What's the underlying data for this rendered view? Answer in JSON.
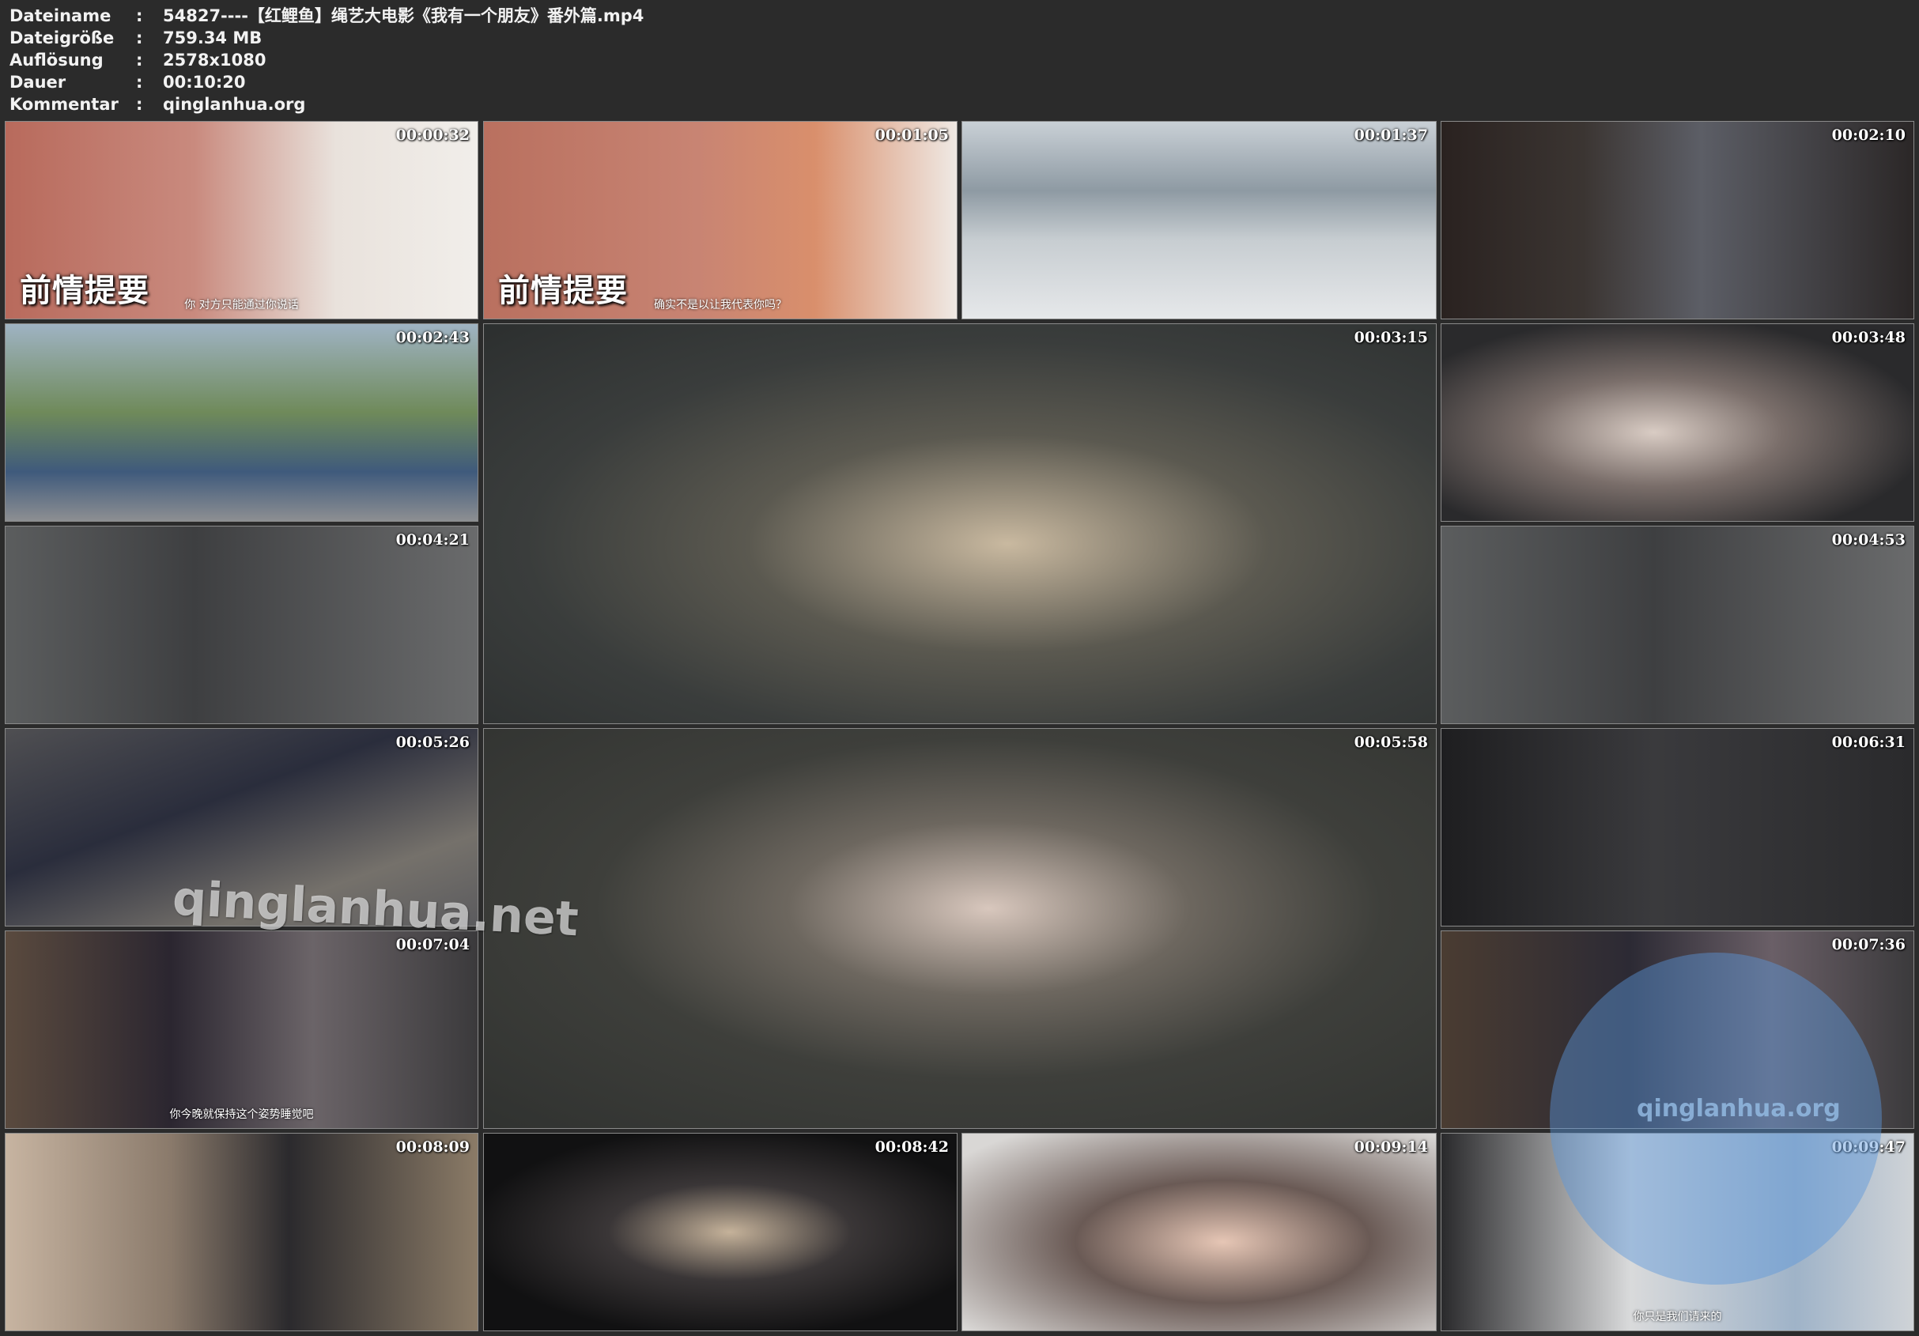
{
  "info": {
    "rows": [
      {
        "key": "Dateiname",
        "value": "54827----【红鲤鱼】绳艺大电影《我有一个朋友》番外篇.mp4"
      },
      {
        "key": "Dateigröße",
        "value": "759.34 MB"
      },
      {
        "key": "Auflösung",
        "value": "2578x1080"
      },
      {
        "key": "Dauer",
        "value": "00:10:20"
      },
      {
        "key": "Kommentar",
        "value": "qinglanhua.org"
      }
    ],
    "separator": ":"
  },
  "thumbnails": [
    {
      "time": "00:00:32",
      "caption": "前情提要",
      "subtitle": "你 对方只能通过你说话"
    },
    {
      "time": "00:01:05",
      "caption": "前情提要",
      "subtitle": "确实不是以让我代表你吗？"
    },
    {
      "time": "00:01:37"
    },
    {
      "time": "00:02:10"
    },
    {
      "time": "00:02:43"
    },
    {
      "time": "00:03:15"
    },
    {
      "time": "00:03:48"
    },
    {
      "time": "00:04:21"
    },
    {
      "time": "00:04:53"
    },
    {
      "time": "00:05:26"
    },
    {
      "time": "00:05:58"
    },
    {
      "time": "00:06:31"
    },
    {
      "time": "00:07:04",
      "subtitle": "你今晚就保持这个姿势睡觉吧"
    },
    {
      "time": "00:07:36"
    },
    {
      "time": "00:08:09"
    },
    {
      "time": "00:08:42"
    },
    {
      "time": "00:09:14"
    },
    {
      "time": "00:09:47",
      "subtitle": "你只是我们请来的"
    }
  ],
  "watermarks": {
    "main": "qinglanhua.net",
    "secondary": "qinglanhua.org"
  },
  "colors": {
    "background": "#2b2b2b",
    "text": "#f2f2f2"
  }
}
